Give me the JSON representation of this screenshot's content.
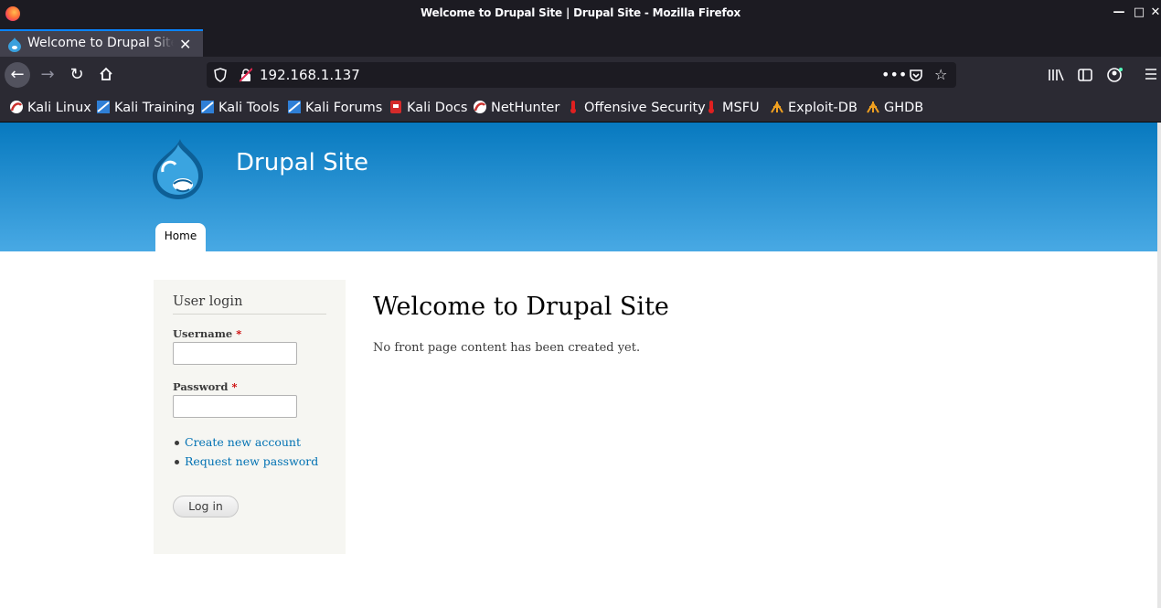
{
  "window": {
    "title": "Welcome to Drupal Site | Drupal Site - Mozilla Firefox"
  },
  "tab": {
    "title": "Welcome to Drupal Site | Drupal Site"
  },
  "urlbar": {
    "url": "192.168.1.137"
  },
  "bookmarks": [
    {
      "label": "Kali Linux",
      "icon": "kali-dragon-icon"
    },
    {
      "label": "Kali Training",
      "icon": "kali-training-icon"
    },
    {
      "label": "Kali Tools",
      "icon": "kali-tools-icon"
    },
    {
      "label": "Kali Forums",
      "icon": "kali-forums-icon"
    },
    {
      "label": "Kali Docs",
      "icon": "kali-docs-icon"
    },
    {
      "label": "NetHunter",
      "icon": "nethunter-icon"
    },
    {
      "label": "Offensive Security",
      "icon": "offsec-icon"
    },
    {
      "label": "MSFU",
      "icon": "msfu-icon"
    },
    {
      "label": "Exploit-DB",
      "icon": "exploitdb-icon"
    },
    {
      "label": "GHDB",
      "icon": "ghdb-icon"
    }
  ],
  "site": {
    "name": "Drupal Site",
    "nav": {
      "home": "Home"
    }
  },
  "login": {
    "title": "User login",
    "username_label": "Username",
    "password_label": "Password",
    "required_marker": "*",
    "username_value": "",
    "password_value": "",
    "links": [
      "Create new account",
      "Request new password"
    ],
    "submit": "Log in"
  },
  "main": {
    "heading": "Welcome to Drupal Site",
    "body": "No front page content has been created yet."
  },
  "colors": {
    "header_top": "#0779bf",
    "header_bottom": "#48a9e4",
    "link": "#0071b3",
    "browser_dark": "#1c1b22",
    "toolbar": "#2b2a33"
  }
}
